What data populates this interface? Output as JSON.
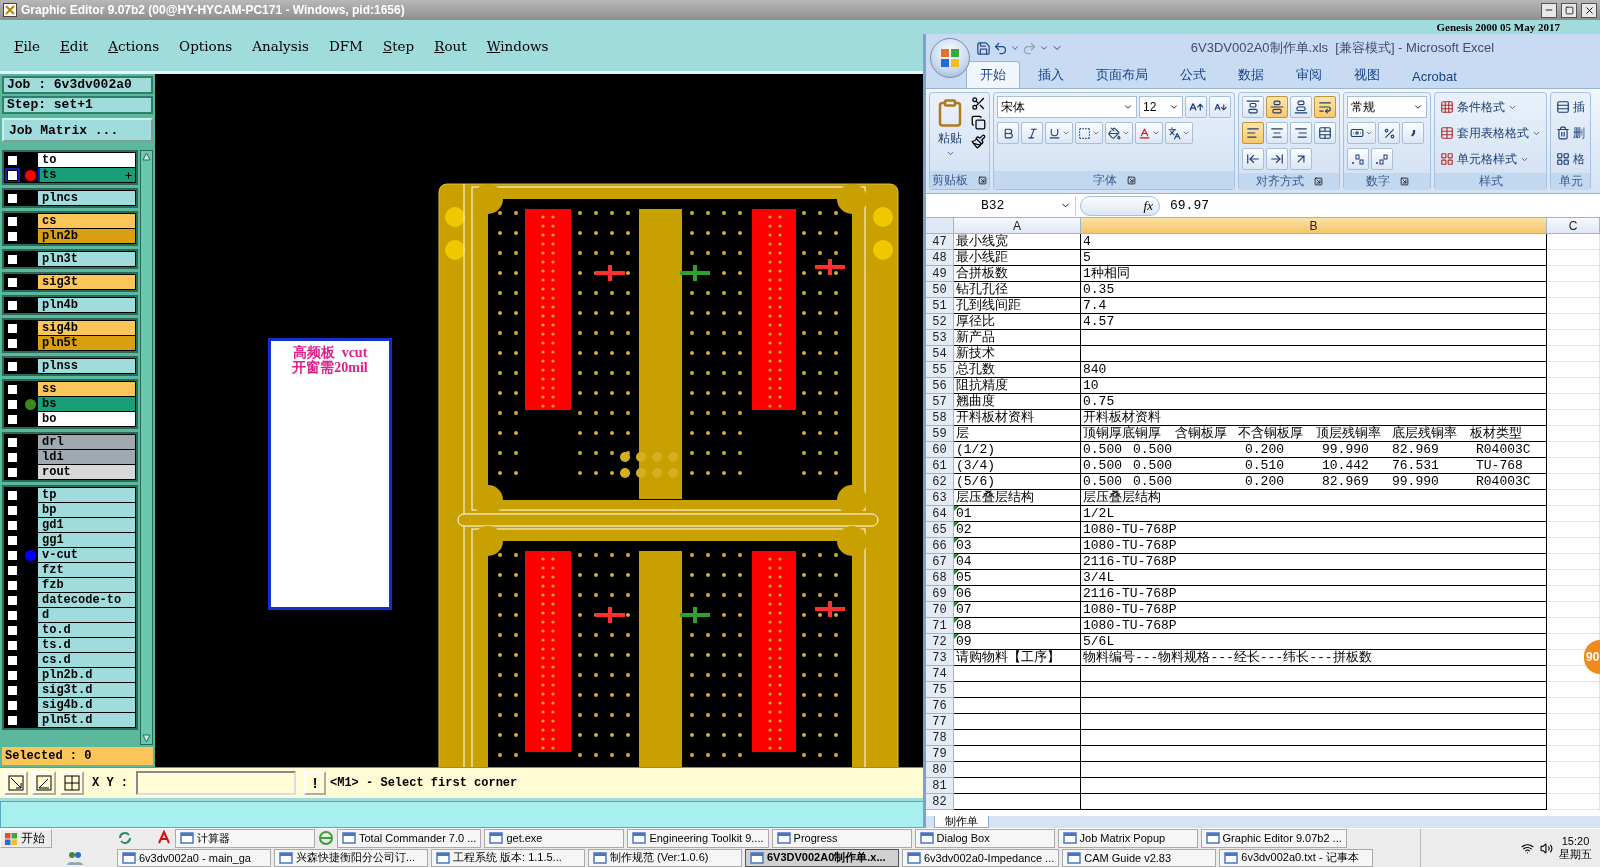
{
  "window": {
    "title": "Graphic Editor 9.07b2 (00@HY-HYCAM-PC171 - Windows, pid:1656)"
  },
  "menu": [
    {
      "label": "File",
      "mnemonic": true
    },
    {
      "label": "Edit",
      "mnemonic": true
    },
    {
      "label": "Actions",
      "mnemonic": true
    },
    {
      "label": "Options",
      "mnemonic": false
    },
    {
      "label": "Analysis",
      "mnemonic": false
    },
    {
      "label": "DFM",
      "mnemonic": false
    },
    {
      "label": "Step",
      "mnemonic": true
    },
    {
      "label": "Rout",
      "mnemonic": true
    },
    {
      "label": "Windows",
      "mnemonic": true
    }
  ],
  "banner": "Genesis 2000 05 May 2017",
  "job": "Job : 6v3dv002a0",
  "step": "Step: set+1",
  "job_matrix_button": "Job Matrix ...",
  "layer_groups": [
    {
      "layers": [
        {
          "name": "to",
          "color": "#ffffff",
          "selected": false,
          "checked": false
        },
        {
          "name": "ts",
          "color": "#1a9e78",
          "dot": {
            "color": "#ff0000"
          },
          "selected": true,
          "checked": false,
          "expandable": true
        }
      ]
    },
    {
      "layers": [
        {
          "name": "plncs",
          "color": "#a0dcdc",
          "selected": false,
          "checked": false
        }
      ]
    },
    {
      "layers": [
        {
          "name": "cs",
          "color": "#fcc55a",
          "selected": false,
          "checked": false
        },
        {
          "name": "pln2b",
          "color": "#d8a010",
          "selected": false,
          "checked": false
        }
      ]
    },
    {
      "layers": [
        {
          "name": "pln3t",
          "color": "#a0dcdc",
          "selected": false,
          "checked": false
        }
      ]
    },
    {
      "layers": [
        {
          "name": "sig3t",
          "color": "#fcc55a",
          "selected": false,
          "checked": false
        }
      ]
    },
    {
      "layers": [
        {
          "name": "pln4b",
          "color": "#a0dcdc",
          "selected": false,
          "checked": false
        }
      ]
    },
    {
      "layers": [
        {
          "name": "sig4b",
          "color": "#fcc55a",
          "selected": false,
          "checked": false
        },
        {
          "name": "pln5t",
          "color": "#d8a010",
          "selected": false,
          "checked": false
        }
      ]
    },
    {
      "layers": [
        {
          "name": "plnss",
          "color": "#a0dcdc",
          "selected": false,
          "checked": false
        }
      ]
    },
    {
      "layers": [
        {
          "name": "ss",
          "color": "#fcc55a",
          "selected": false,
          "checked": false
        },
        {
          "name": "bs",
          "color": "#1a9e78",
          "dot": {
            "color": "#3a8a1a"
          },
          "selected": false,
          "checked": false
        },
        {
          "name": "bo",
          "color": "#ffffff",
          "selected": false,
          "checked": false
        }
      ]
    },
    {
      "layers": [
        {
          "name": "drl",
          "color": "#a0a8b0",
          "selected": false,
          "checked": false
        },
        {
          "name": "ldi",
          "color": "#a0a8b0",
          "selected": false,
          "checked": false
        },
        {
          "name": "rout",
          "color": "#d8d8d8",
          "selected": false,
          "checked": false
        }
      ]
    },
    {
      "layers": [
        {
          "name": "tp",
          "color": "#a0dcdc",
          "selected": false,
          "checked": false
        },
        {
          "name": "bp",
          "color": "#a0dcdc",
          "selected": false,
          "checked": false
        },
        {
          "name": "gd1",
          "color": "#a0dcdc",
          "selected": false,
          "checked": false
        },
        {
          "name": "gg1",
          "color": "#a0dcdc",
          "selected": false,
          "checked": false
        },
        {
          "name": "v-cut",
          "color": "#a0dcdc",
          "dot": {
            "color": "#0000ff"
          },
          "selected": false,
          "checked": false
        },
        {
          "name": "fzt",
          "color": "#a0dcdc",
          "selected": false,
          "checked": false
        },
        {
          "name": "fzb",
          "color": "#a0dcdc",
          "selected": false,
          "checked": false
        },
        {
          "name": "datecode-to",
          "color": "#a0dcdc",
          "selected": false,
          "checked": false
        },
        {
          "name": "d",
          "color": "#a0dcdc",
          "selected": false,
          "checked": false
        },
        {
          "name": "to.d",
          "color": "#a0dcdc",
          "selected": false,
          "checked": false
        },
        {
          "name": "ts.d",
          "color": "#a0dcdc",
          "selected": false,
          "checked": false
        },
        {
          "name": "cs.d",
          "color": "#a0dcdc",
          "selected": false,
          "checked": false
        },
        {
          "name": "pln2b.d",
          "color": "#a0dcdc",
          "selected": false,
          "checked": false
        },
        {
          "name": "sig3t.d",
          "color": "#a0dcdc",
          "selected": false,
          "checked": false
        },
        {
          "name": "sig4b.d",
          "color": "#a0dcdc",
          "selected": false,
          "checked": false
        },
        {
          "name": "pln5t.d",
          "color": "#a0dcdc",
          "selected": false,
          "checked": false
        }
      ]
    }
  ],
  "selected_count": "Selected : 0",
  "canvas": {
    "note": [
      "高频板  vcut",
      "开窗需20mil"
    ]
  },
  "toolbar": {
    "xy_label": "X Y :",
    "bang": "!",
    "message": "<M1> - Select first corner"
  },
  "excel": {
    "title": "6V3DV002A0制作单.xls  [兼容模式] - Microsoft Excel",
    "tabs": [
      {
        "label": "开始",
        "selected": true
      },
      {
        "label": "插入",
        "selected": false
      },
      {
        "label": "页面布局",
        "selected": false
      },
      {
        "label": "公式",
        "selected": false
      },
      {
        "label": "数据",
        "selected": false
      },
      {
        "label": "审阅",
        "selected": false
      },
      {
        "label": "视图",
        "selected": false
      },
      {
        "label": "Acrobat",
        "selected": false
      }
    ],
    "paste": "粘贴",
    "font": "宋体",
    "size": "12",
    "number_format": "常规",
    "align": [
      {
        "kind": "top",
        "selected": false
      },
      {
        "kind": "middle",
        "selected": true
      },
      {
        "kind": "bottom",
        "selected": false
      },
      {
        "kind": "wrap",
        "selected": true
      },
      {
        "kind": "left",
        "selected": true
      },
      {
        "kind": "center",
        "selected": false
      },
      {
        "kind": "right",
        "selected": false
      },
      {
        "kind": "merge",
        "selected": false
      },
      {
        "kind": "outdent",
        "selected": false
      },
      {
        "kind": "indent",
        "selected": false
      },
      {
        "kind": "orient",
        "selected": false
      }
    ],
    "styles": [
      "条件格式",
      "套用表格格式",
      "单元格样式"
    ],
    "cells": [
      "插",
      "删",
      "格"
    ],
    "groups": [
      "剪贴板",
      "字体",
      "对齐方式",
      "数字",
      "样式",
      "单元"
    ],
    "name_box": "B32",
    "fx": "fx",
    "formula": "69.97",
    "columns": [
      {
        "label": "A",
        "selected": false
      },
      {
        "label": "B",
        "selected": true
      },
      {
        "label": "C",
        "selected": false
      }
    ],
    "rows": [
      {
        "n": "47",
        "kind": "text",
        "a": "最小线宽",
        "b": "4",
        "flagged": false
      },
      {
        "n": "48",
        "kind": "text",
        "a": "最小线距",
        "b": "5",
        "flagged": false
      },
      {
        "n": "49",
        "kind": "text",
        "a": "合拼板数",
        "b": "1种相同",
        "flagged": false
      },
      {
        "n": "50",
        "kind": "text",
        "a": "钻孔孔径",
        "b": "0.35",
        "flagged": false
      },
      {
        "n": "51",
        "kind": "text",
        "a": "孔到线间距",
        "b": "7.4",
        "flagged": false
      },
      {
        "n": "52",
        "kind": "text",
        "a": "厚径比",
        "b": "4.57",
        "flagged": false
      },
      {
        "n": "53",
        "kind": "text",
        "a": "新产品",
        "flagged": false
      },
      {
        "n": "54",
        "kind": "text",
        "a": "新技术",
        "flagged": false
      },
      {
        "n": "55",
        "kind": "text",
        "a": "总孔数",
        "b": "840",
        "flagged": false
      },
      {
        "n": "56",
        "kind": "text",
        "a": "阻抗精度",
        "b": "10",
        "flagged": false
      },
      {
        "n": "57",
        "kind": "text",
        "a": "翘曲度",
        "b": "0.75",
        "flagged": false
      },
      {
        "n": "58",
        "kind": "text",
        "a": "开料板材资料",
        "b": "开料板材资料",
        "flagged": false
      },
      {
        "n": "59",
        "kind": "header",
        "a": "层",
        "parts": [
          "顶铜厚底铜厚",
          "含铜板厚",
          "不含铜板厚",
          "顶层残铜率",
          "底层残铜率",
          "板材类型"
        ],
        "flagged": false
      },
      {
        "n": "60",
        "kind": "values",
        "a": "(1/2)",
        "parts": [
          "0.500",
          "0.500",
          "0.200",
          "99.990",
          "82.969",
          "R04003C"
        ],
        "flagged": false
      },
      {
        "n": "61",
        "kind": "values",
        "a": "(3/4)",
        "parts": [
          "0.500",
          "0.500",
          "0.510",
          "10.442",
          "76.531",
          "TU-768"
        ],
        "flagged": false
      },
      {
        "n": "62",
        "kind": "values",
        "a": "(5/6)",
        "parts": [
          "0.500",
          "0.500",
          "0.200",
          "82.969",
          "99.990",
          "R04003C"
        ],
        "flagged": false
      },
      {
        "n": "63",
        "kind": "text",
        "a": "层压叠层结构",
        "b": "层压叠层结构",
        "flagged": false
      },
      {
        "n": "64",
        "kind": "text",
        "a": "01",
        "b": "1/2L",
        "flagged": true
      },
      {
        "n": "65",
        "kind": "text",
        "a": "02",
        "b": "1080-TU-768P",
        "flagged": true
      },
      {
        "n": "66",
        "kind": "text",
        "a": "03",
        "b": "1080-TU-768P",
        "flagged": true
      },
      {
        "n": "67",
        "kind": "text",
        "a": "04",
        "b": "2116-TU-768P",
        "flagged": true
      },
      {
        "n": "68",
        "kind": "text",
        "a": "05",
        "b": "3/4L",
        "flagged": true
      },
      {
        "n": "69",
        "kind": "text",
        "a": "06",
        "b": "2116-TU-768P",
        "flagged": true
      },
      {
        "n": "70",
        "kind": "text",
        "a": "07",
        "b": "1080-TU-768P",
        "flagged": true
      },
      {
        "n": "71",
        "kind": "text",
        "a": "08",
        "b": "1080-TU-768P",
        "flagged": true
      },
      {
        "n": "72",
        "kind": "text",
        "a": "09",
        "b": "5/6L",
        "flagged": true
      },
      {
        "n": "73",
        "kind": "text",
        "a": "请购物料【工序】",
        "b": "物料编号---物料规格---经长---纬长---拼板数",
        "flagged": false
      },
      {
        "n": "74",
        "kind": "text",
        "flagged": false
      },
      {
        "n": "75",
        "kind": "text",
        "flagged": false
      },
      {
        "n": "76",
        "kind": "text",
        "flagged": false
      },
      {
        "n": "77",
        "kind": "text",
        "flagged": false
      },
      {
        "n": "78",
        "kind": "text",
        "flagged": false
      },
      {
        "n": "79",
        "kind": "text",
        "flagged": false
      },
      {
        "n": "80",
        "kind": "text",
        "flagged": false
      },
      {
        "n": "81",
        "kind": "text",
        "flagged": false
      },
      {
        "n": "82",
        "kind": "text",
        "flagged": false
      }
    ],
    "sheet_tab": "制作单"
  },
  "floating_badge": "90",
  "taskbar": {
    "start": "开始",
    "row1": [
      {
        "label": "计算器",
        "selected": false
      },
      {
        "label": "Total Commander 7.0 ...",
        "selected": false
      },
      {
        "label": "get.exe",
        "selected": false
      },
      {
        "label": "Engineering Toolkit 9....",
        "selected": false
      },
      {
        "label": "Progress",
        "selected": false
      },
      {
        "label": "Dialog Box",
        "selected": false
      },
      {
        "label": "Job Matrix Popup",
        "selected": false
      },
      {
        "label": "Graphic Editor 9.07b2 ...",
        "selected": false
      }
    ],
    "row2": [
      {
        "label": "6v3dv002a0 - main_ga",
        "selected": false
      },
      {
        "label": "兴森快捷衡阳分公司订...",
        "selected": false
      },
      {
        "label": "工程系统  版本: 1.1.5...",
        "selected": false
      },
      {
        "label": "制作规范 (Ver:1.0.6)",
        "selected": false
      },
      {
        "label": "6V3DV002A0制作单.x...",
        "selected": true
      },
      {
        "label": "6v3dv002a0-Impedance ...",
        "selected": false
      },
      {
        "label": "CAM  Guide v2.83",
        "selected": false
      },
      {
        "label": "6v3dv002a0.txt - 记事本",
        "selected": false
      }
    ],
    "clock": "15:20",
    "day": "星期五"
  }
}
